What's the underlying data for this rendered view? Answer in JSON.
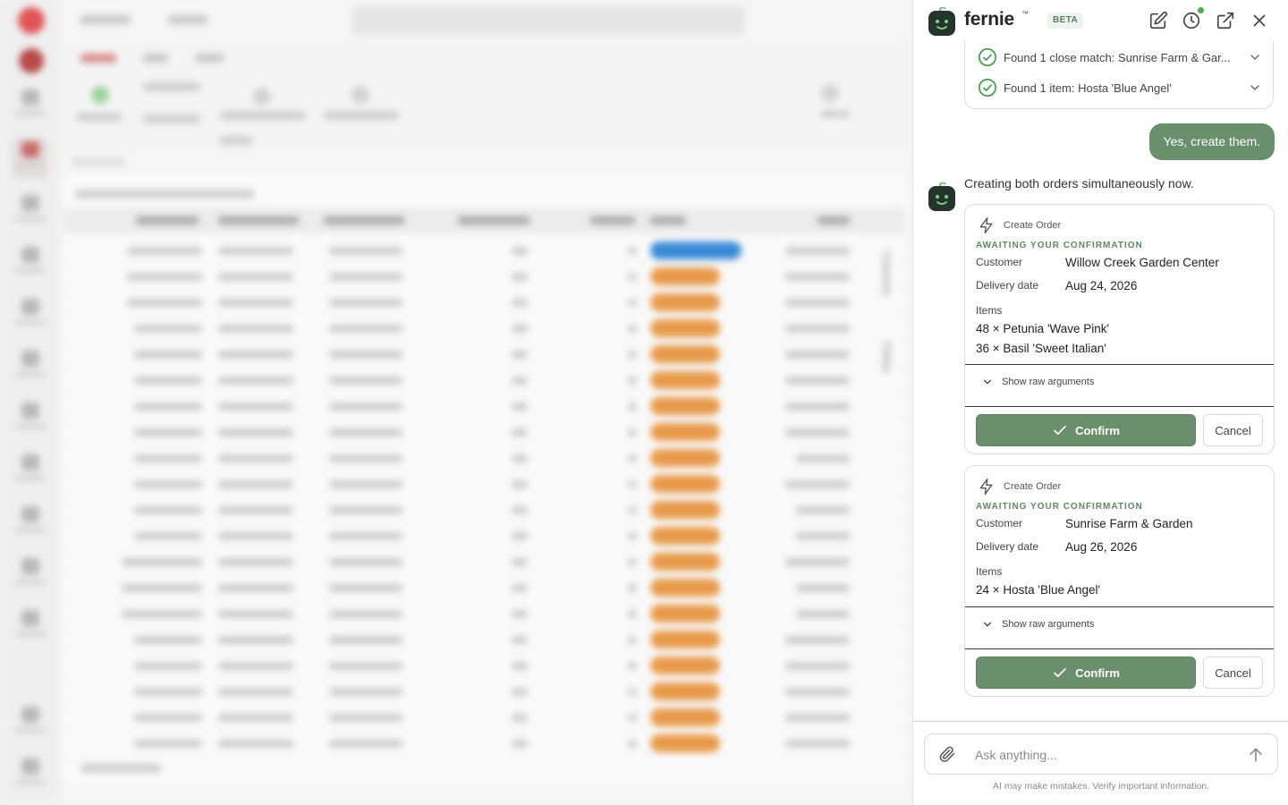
{
  "background": {
    "avatar_initials": "DE",
    "side_text": "alized",
    "vertical_tabs": [
      "Columns",
      "Filters"
    ]
  },
  "chat": {
    "brand": {
      "name": "fernie",
      "tm": "™",
      "badge": "BETA"
    },
    "header_icons": [
      "new-chat-icon",
      "history-icon",
      "open-external-icon",
      "close-icon"
    ],
    "found_items": [
      {
        "text": "Found 1 close match: Sunrise Farm & Gar..."
      },
      {
        "text": "Found 1 item: Hosta 'Blue Angel'"
      }
    ],
    "user_message": "Yes, create them.",
    "assistant_message": "Creating both orders simultaneously now.",
    "orders": [
      {
        "title": "Create Order",
        "status": "AWAITING YOUR CONFIRMATION",
        "customer_label": "Customer",
        "customer": "Willow Creek Garden Center",
        "delivery_label": "Delivery date",
        "delivery": "Aug 24, 2026",
        "items_label": "Items",
        "items": [
          "48 × Petunia 'Wave Pink'",
          "36 × Basil 'Sweet Italian'"
        ],
        "raw_label": "Show raw arguments",
        "confirm_label": "Confirm",
        "cancel_label": "Cancel"
      },
      {
        "title": "Create Order",
        "status": "AWAITING YOUR CONFIRMATION",
        "customer_label": "Customer",
        "customer": "Sunrise Farm & Garden",
        "delivery_label": "Delivery date",
        "delivery": "Aug 26, 2026",
        "items_label": "Items",
        "items": [
          "24 × Hosta 'Blue Angel'"
        ],
        "raw_label": "Show raw arguments",
        "confirm_label": "Confirm",
        "cancel_label": "Cancel"
      }
    ],
    "composer": {
      "placeholder": "Ask anything..."
    },
    "disclaimer": "AI may make mistakes. Verify important information.",
    "colors": {
      "accent": "#6b8f6c",
      "status": "#5e8a62",
      "notification": "#4caf50"
    }
  }
}
